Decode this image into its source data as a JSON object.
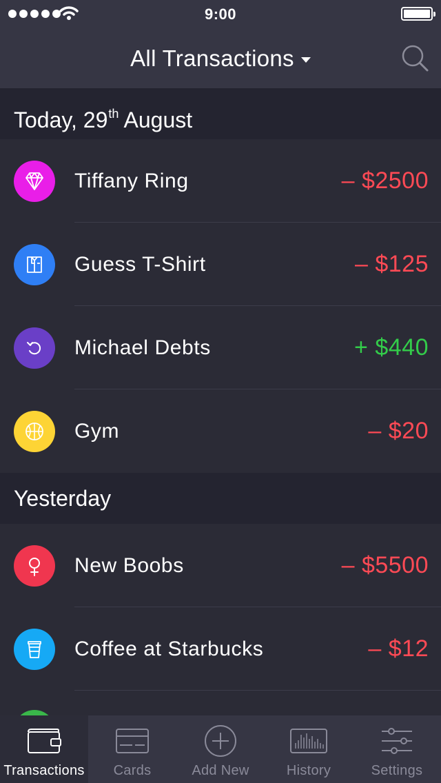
{
  "status_bar": {
    "time": "9:00"
  },
  "header": {
    "title": "All Transactions"
  },
  "sections": [
    {
      "label": "Today, 29",
      "label_sup": "th",
      "label_tail": " August"
    },
    {
      "label": "Yesterday"
    }
  ],
  "transactions_today": [
    {
      "name": "Tiffany Ring",
      "amount": "– $2500",
      "icon": "diamond-icon",
      "color": "#e91ee8",
      "type": "expense"
    },
    {
      "name": "Guess T-Shirt",
      "amount": "– $125",
      "icon": "shirt-icon",
      "color": "#2f7ff5",
      "type": "expense"
    },
    {
      "name": "Michael Debts",
      "amount": "+ $440",
      "icon": "refresh-icon",
      "color": "#6a3fc7",
      "type": "income"
    },
    {
      "name": "Gym",
      "amount": "– $20",
      "icon": "basketball-icon",
      "color": "#fdd435",
      "type": "expense"
    }
  ],
  "transactions_yesterday": [
    {
      "name": "New Boobs",
      "amount": "– $5500",
      "icon": "female-icon",
      "color": "#f0364f",
      "type": "expense"
    },
    {
      "name": "Coffee at Starbucks",
      "amount": "– $12",
      "icon": "coffee-cup-icon",
      "color": "#16a9f5",
      "type": "expense"
    }
  ],
  "tabbar": {
    "items": [
      {
        "label": "Transactions",
        "icon": "wallet-icon",
        "active": true
      },
      {
        "label": "Cards",
        "icon": "card-icon",
        "active": false
      },
      {
        "label": "Add New",
        "icon": "plus-circle-icon",
        "active": false
      },
      {
        "label": "History",
        "icon": "history-bars-icon",
        "active": false
      },
      {
        "label": "Settings",
        "icon": "sliders-icon",
        "active": false
      }
    ]
  },
  "colors": {
    "background": "#2b2b36",
    "header": "#363644",
    "section": "#242430",
    "negative": "#ff4a55",
    "positive": "#33cc4a"
  }
}
